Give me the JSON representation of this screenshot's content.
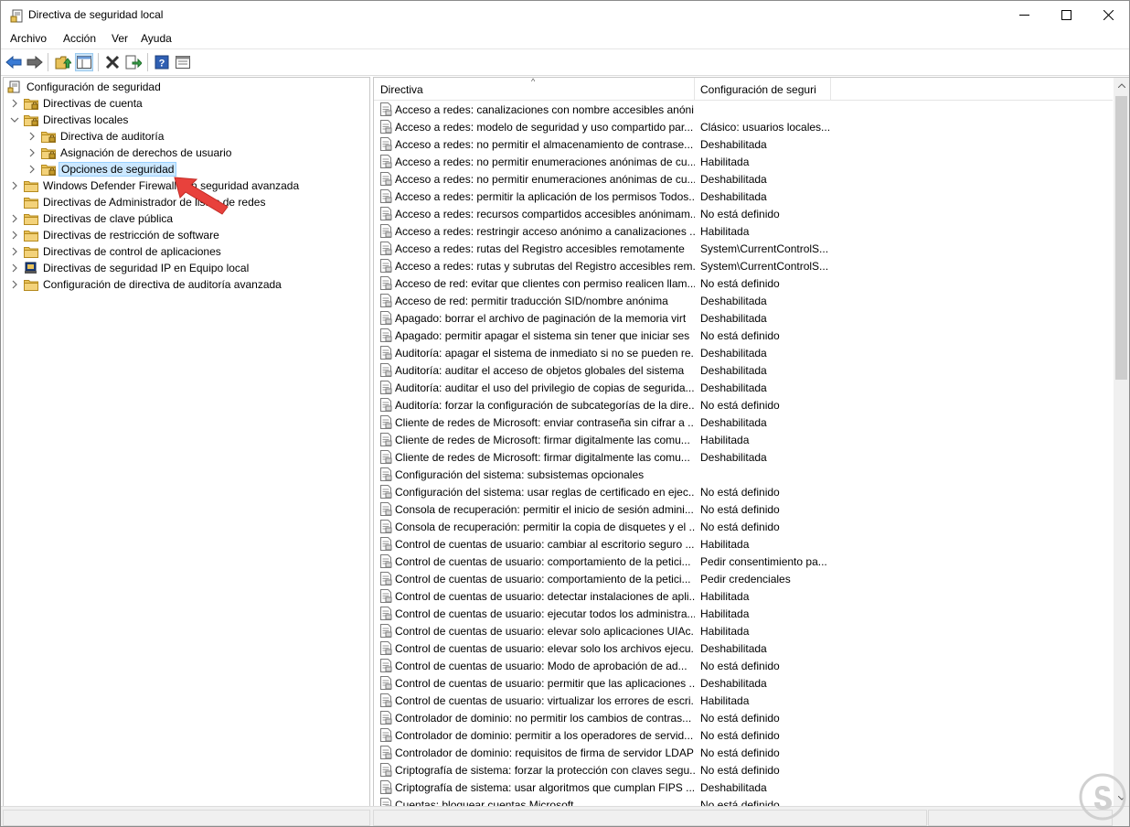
{
  "window": {
    "title": "Directiva de seguridad local",
    "controls": {
      "minimize": "minimize-icon",
      "maximize": "maximize-icon",
      "close": "close-icon"
    }
  },
  "menubar": {
    "items": [
      {
        "label": "Archivo"
      },
      {
        "label": "Acción"
      },
      {
        "label": "Ver"
      },
      {
        "label": "Ayuda"
      }
    ]
  },
  "toolbar": {
    "buttons": [
      "back-icon",
      "forward-icon",
      "up-folder-icon",
      "show-hide-tree-icon",
      "delete-icon",
      "export-list-icon",
      "help-icon",
      "properties-icon"
    ]
  },
  "tree": {
    "root": {
      "label": "Configuración de seguridad"
    },
    "nodes": [
      {
        "label": "Directivas de cuenta"
      },
      {
        "label": "Directivas locales"
      },
      {
        "label": "Directiva de auditoría"
      },
      {
        "label": "Asignación de derechos de usuario"
      },
      {
        "label": "Opciones de seguridad"
      },
      {
        "label": "Windows Defender Firewall con seguridad avanzada"
      },
      {
        "label": "Directivas de Administrador de listas de redes"
      },
      {
        "label": "Directivas de clave pública"
      },
      {
        "label": "Directivas de restricción de software"
      },
      {
        "label": "Directivas de control de aplicaciones"
      },
      {
        "label": "Directivas de seguridad IP en Equipo local"
      },
      {
        "label": "Configuración de directiva de auditoría avanzada"
      }
    ]
  },
  "list": {
    "columns": {
      "name": "Directiva",
      "value": "Configuración de seguri"
    },
    "rows": [
      {
        "name": "Acceso a redes: canalizaciones con nombre accesibles anóni...",
        "value": ""
      },
      {
        "name": "Acceso a redes: modelo de seguridad y uso compartido par...",
        "value": "Clásico: usuarios locales..."
      },
      {
        "name": "Acceso a redes: no permitir el almacenamiento de contrase...",
        "value": "Deshabilitada"
      },
      {
        "name": "Acceso a redes: no permitir enumeraciones anónimas de cu...",
        "value": "Habilitada"
      },
      {
        "name": "Acceso a redes: no permitir enumeraciones anónimas de cu...",
        "value": "Deshabilitada"
      },
      {
        "name": "Acceso a redes: permitir la aplicación de los permisos Todos...",
        "value": "Deshabilitada"
      },
      {
        "name": "Acceso a redes: recursos compartidos accesibles anónimam...",
        "value": "No está definido"
      },
      {
        "name": "Acceso a redes: restringir acceso anónimo a canalizaciones ...",
        "value": "Habilitada"
      },
      {
        "name": "Acceso a redes: rutas del Registro accesibles remotamente",
        "value": "System\\CurrentControlS..."
      },
      {
        "name": "Acceso a redes: rutas y subrutas del Registro accesibles rem...",
        "value": "System\\CurrentControlS..."
      },
      {
        "name": "Acceso de red: evitar que clientes con permiso realicen llam...",
        "value": "No está definido"
      },
      {
        "name": "Acceso de red: permitir traducción SID/nombre anónima",
        "value": "Deshabilitada"
      },
      {
        "name": "Apagado: borrar el archivo de paginación de la memoria virt",
        "value": "Deshabilitada"
      },
      {
        "name": "Apagado: permitir apagar el sistema sin tener que iniciar ses",
        "value": "No está definido"
      },
      {
        "name": "Auditoría: apagar el sistema de inmediato si no se pueden re...",
        "value": "Deshabilitada"
      },
      {
        "name": "Auditoría: auditar el acceso de objetos globales del sistema",
        "value": "Deshabilitada"
      },
      {
        "name": "Auditoría: auditar el uso del privilegio de copias de segurida...",
        "value": "Deshabilitada"
      },
      {
        "name": "Auditoría: forzar la configuración de subcategorías de la dire...",
        "value": "No está definido"
      },
      {
        "name": "Cliente de redes de Microsoft: enviar contraseña sin cifrar a ...",
        "value": "Deshabilitada"
      },
      {
        "name": "Cliente de redes de Microsoft: firmar digitalmente las comu...",
        "value": "Habilitada"
      },
      {
        "name": "Cliente de redes de Microsoft: firmar digitalmente las comu...",
        "value": "Deshabilitada"
      },
      {
        "name": "Configuración del sistema: subsistemas opcionales",
        "value": ""
      },
      {
        "name": "Configuración del sistema: usar reglas de certificado en ejec...",
        "value": "No está definido"
      },
      {
        "name": "Consola de recuperación: permitir el inicio de sesión admini...",
        "value": "No está definido"
      },
      {
        "name": "Consola de recuperación: permitir la copia de disquetes y el ...",
        "value": "No está definido"
      },
      {
        "name": "Control de cuentas de usuario: cambiar al escritorio seguro ...",
        "value": "Habilitada"
      },
      {
        "name": "Control de cuentas de usuario: comportamiento de la petici...",
        "value": "Pedir consentimiento pa..."
      },
      {
        "name": "Control de cuentas de usuario: comportamiento de la petici...",
        "value": "Pedir credenciales"
      },
      {
        "name": "Control de cuentas de usuario: detectar instalaciones de apli...",
        "value": "Habilitada"
      },
      {
        "name": "Control de cuentas de usuario: ejecutar todos los administra...",
        "value": "Habilitada"
      },
      {
        "name": "Control de cuentas de usuario: elevar solo aplicaciones UIAc...",
        "value": "Habilitada"
      },
      {
        "name": "Control de cuentas de usuario: elevar solo los archivos ejecu...",
        "value": "Deshabilitada"
      },
      {
        "name": "Control de cuentas de usuario: Modo de aprobación de ad...",
        "value": "No está definido"
      },
      {
        "name": "Control de cuentas de usuario: permitir que las aplicaciones ...",
        "value": "Deshabilitada"
      },
      {
        "name": "Control de cuentas de usuario: virtualizar los errores de escri...",
        "value": "Habilitada"
      },
      {
        "name": "Controlador de dominio: no permitir los cambios de contras...",
        "value": "No está definido"
      },
      {
        "name": "Controlador de dominio: permitir a los operadores de servid...",
        "value": "No está definido"
      },
      {
        "name": "Controlador de dominio: requisitos de firma de servidor LDAP",
        "value": "No está definido"
      },
      {
        "name": "Criptografía de sistema: forzar la protección con claves segu...",
        "value": "No está definido"
      },
      {
        "name": "Criptografía de sistema: usar algoritmos que cumplan FIPS ...",
        "value": "Deshabilitada"
      },
      {
        "name": "Cuentas: bloquear cuentas Microsoft",
        "value": "No está definido"
      }
    ]
  },
  "colors": {
    "selection": "#cce8ff",
    "folder": "#e8c25a",
    "annotation_arrow": "#e8413c"
  }
}
